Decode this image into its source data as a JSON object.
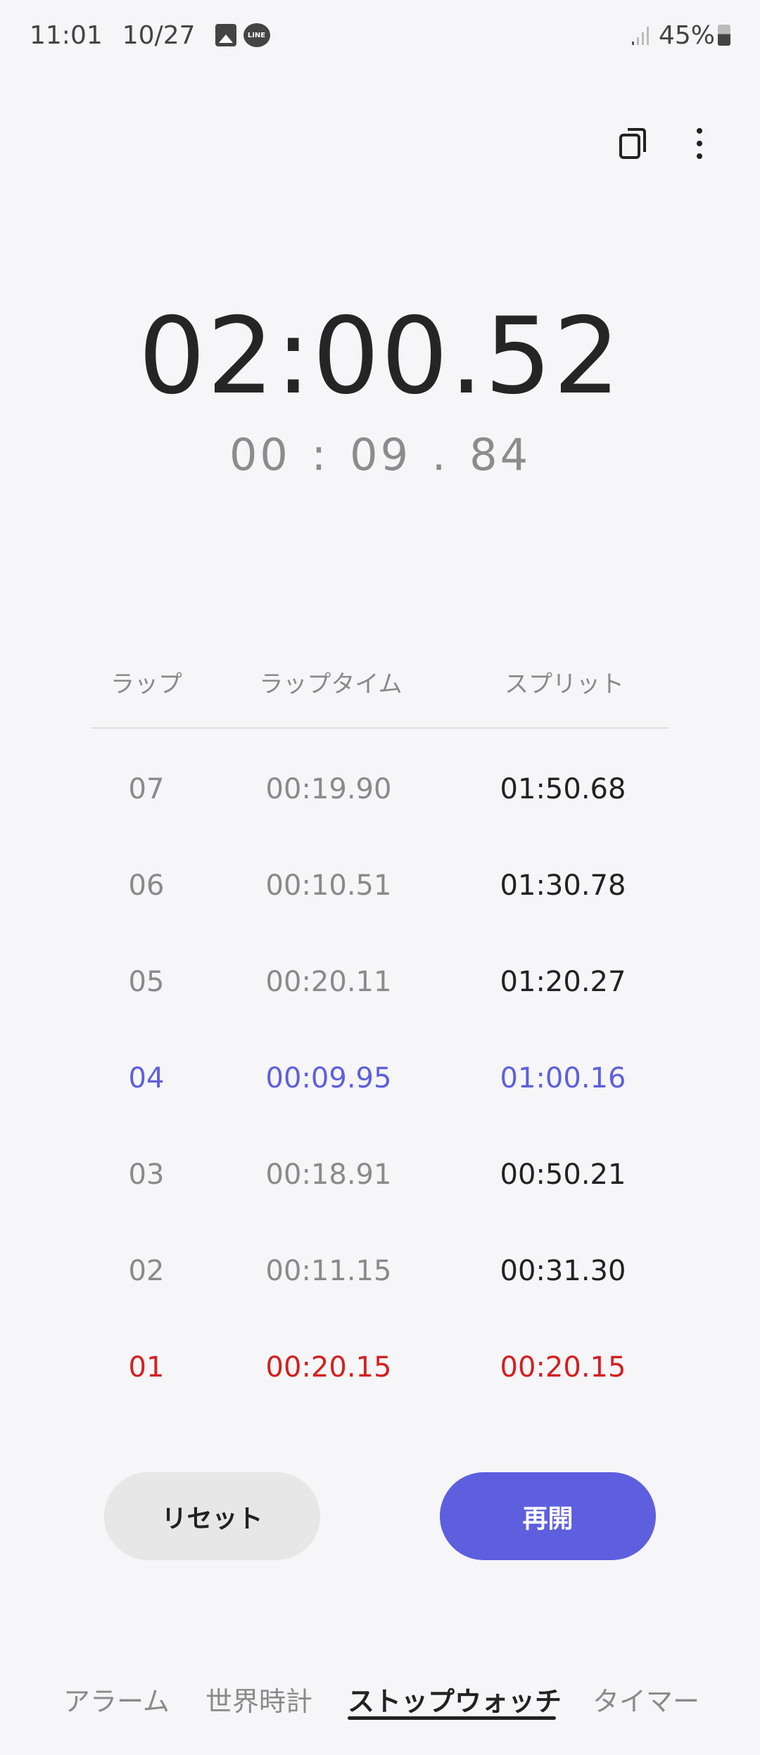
{
  "status_bar": {
    "time": "11:01",
    "date": "10/27",
    "battery": "45%",
    "icons": [
      "gallery-icon",
      "line-app-icon",
      "signal-icon",
      "battery-icon"
    ]
  },
  "toolbar": {
    "icons": [
      "copy-icon",
      "more-options-icon"
    ]
  },
  "stopwatch": {
    "main_time": "02:00.52",
    "lap_time": "00 : 09 . 84"
  },
  "laps": {
    "headers": {
      "lap": "ラップ",
      "lap_time": "ラップタイム",
      "split": "スプリット"
    },
    "rows": [
      {
        "lap": "07",
        "lap_time": "00:19.90",
        "split": "01:50.68",
        "highlight": "none"
      },
      {
        "lap": "06",
        "lap_time": "00:10.51",
        "split": "01:30.78",
        "highlight": "none"
      },
      {
        "lap": "05",
        "lap_time": "00:20.11",
        "split": "01:20.27",
        "highlight": "none"
      },
      {
        "lap": "04",
        "lap_time": "00:09.95",
        "split": "01:00.16",
        "highlight": "fastest"
      },
      {
        "lap": "03",
        "lap_time": "00:18.91",
        "split": "00:50.21",
        "highlight": "none"
      },
      {
        "lap": "02",
        "lap_time": "00:11.15",
        "split": "00:31.30",
        "highlight": "none"
      },
      {
        "lap": "01",
        "lap_time": "00:20.15",
        "split": "00:20.15",
        "highlight": "slowest"
      }
    ]
  },
  "buttons": {
    "reset": "リセット",
    "resume": "再開"
  },
  "tabs": [
    {
      "label": "アラーム"
    },
    {
      "label": "世界時計"
    },
    {
      "label": "ストップウォッチ",
      "active": true
    },
    {
      "label": "タイマー"
    }
  ],
  "colors": {
    "accent": "#5e5fdf",
    "fastest": "#5e5fdf",
    "slowest": "#d42020",
    "background": "#f6f6f8"
  }
}
